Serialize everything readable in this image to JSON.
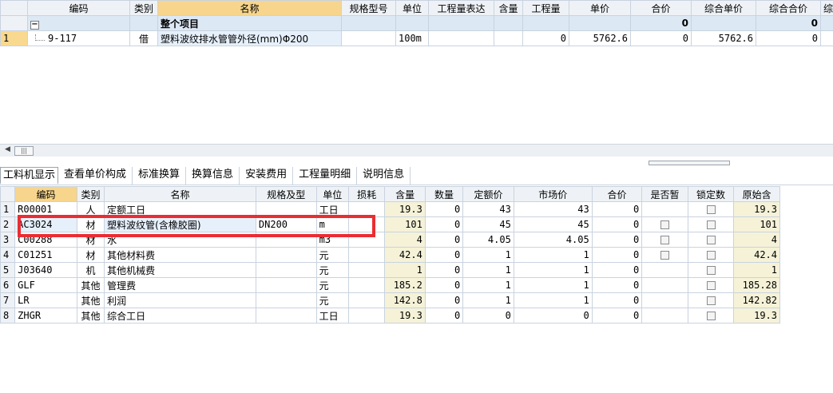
{
  "top_table": {
    "headers": [
      "",
      "编码",
      "类别",
      "名称",
      "规格型号",
      "单位",
      "工程量表达",
      "含量",
      "工程量",
      "单价",
      "合价",
      "综合单价",
      "综合合价",
      "综"
    ],
    "summary": {
      "expander": "−",
      "name": "整个项目",
      "total": "0",
      "comp_total": "0"
    },
    "rows": [
      {
        "rn": "1",
        "code": "9-117",
        "cat": "借",
        "name": "塑料波纹排水管管外径(mm)Φ200",
        "unit": "100m",
        "qty": "0",
        "price": "5762.6",
        "total": "0",
        "comp_price": "5762.6",
        "comp_total": "0"
      }
    ]
  },
  "tabs": [
    "工料机显示",
    "查看单价构成",
    "标准换算",
    "换算信息",
    "安装费用",
    "工程量明细",
    "说明信息"
  ],
  "bottom_table": {
    "headers": [
      "",
      "编码",
      "类别",
      "名称",
      "规格及型",
      "单位",
      "损耗",
      "含量",
      "数量",
      "定额价",
      "市场价",
      "合价",
      "是否暂",
      "锁定数",
      "原始含"
    ],
    "rows": [
      {
        "rn": "1",
        "code": "R00001",
        "cat": "人",
        "name": "定额工日",
        "spec": "",
        "unit": "工日",
        "content": "19.3",
        "qty": "0",
        "fixed": "43",
        "market": "43",
        "total": "0",
        "temp": false,
        "lock": true,
        "orig": "19.3"
      },
      {
        "rn": "2",
        "code": "AC3024",
        "cat": "材",
        "name": "塑料波纹管(含橡胶圈)",
        "spec": "DN200",
        "unit": "m",
        "content": "101",
        "qty": "0",
        "fixed": "45",
        "market": "45",
        "total": "0",
        "temp": true,
        "lock": true,
        "orig": "101"
      },
      {
        "rn": "3",
        "code": "C00288",
        "cat": "材",
        "name": "水",
        "spec": "",
        "unit": "m3",
        "content": "4",
        "qty": "0",
        "fixed": "4.05",
        "market": "4.05",
        "total": "0",
        "temp": true,
        "lock": true,
        "orig": "4"
      },
      {
        "rn": "4",
        "code": "C01251",
        "cat": "材",
        "name": "其他材料费",
        "spec": "",
        "unit": "元",
        "content": "42.4",
        "qty": "0",
        "fixed": "1",
        "market": "1",
        "total": "0",
        "temp": true,
        "lock": true,
        "orig": "42.4"
      },
      {
        "rn": "5",
        "code": "J03640",
        "cat": "机",
        "name": "其他机械费",
        "spec": "",
        "unit": "元",
        "content": "1",
        "qty": "0",
        "fixed": "1",
        "market": "1",
        "total": "0",
        "temp": false,
        "lock": true,
        "orig": "1"
      },
      {
        "rn": "6",
        "code": "GLF",
        "cat": "其他",
        "name": "管理费",
        "spec": "",
        "unit": "元",
        "content": "185.2",
        "qty": "0",
        "fixed": "1",
        "market": "1",
        "total": "0",
        "temp": false,
        "lock": true,
        "orig": "185.28"
      },
      {
        "rn": "7",
        "code": "LR",
        "cat": "其他",
        "name": "利润",
        "spec": "",
        "unit": "元",
        "content": "142.8",
        "qty": "0",
        "fixed": "1",
        "market": "1",
        "total": "0",
        "temp": false,
        "lock": true,
        "orig": "142.82"
      },
      {
        "rn": "8",
        "code": "ZHGR",
        "cat": "其他",
        "name": "综合工日",
        "spec": "",
        "unit": "工日",
        "content": "19.3",
        "qty": "0",
        "fixed": "0",
        "market": "0",
        "total": "0",
        "temp": false,
        "lock": true,
        "orig": "19.3"
      }
    ]
  },
  "scrollbar": {
    "thumb_glyph": "|||"
  },
  "colors": {
    "highlight_header": "#f7d58c",
    "annotation_box": "#ea2d33",
    "grid_line": "#c9d3df"
  }
}
